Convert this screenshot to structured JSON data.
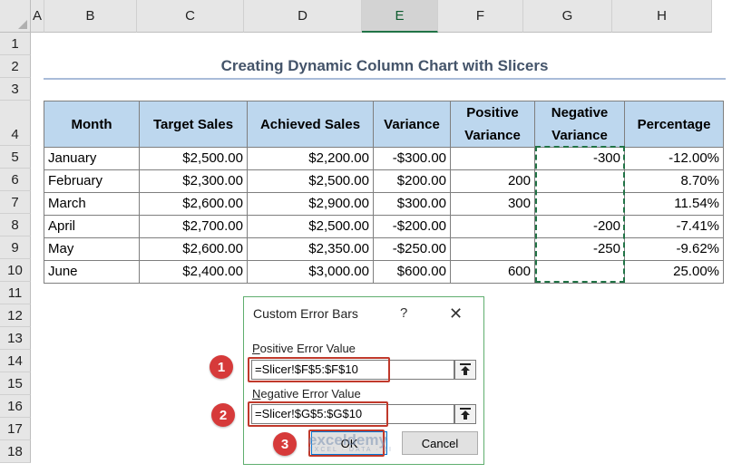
{
  "columns": [
    "A",
    "B",
    "C",
    "D",
    "E",
    "F",
    "G",
    "H"
  ],
  "rows": [
    "1",
    "2",
    "3",
    "4",
    "5",
    "6",
    "7",
    "8",
    "9",
    "10",
    "11",
    "12",
    "13",
    "14",
    "15",
    "16",
    "17",
    "18"
  ],
  "title": "Creating Dynamic Column Chart with Slicers",
  "table": {
    "headers": [
      "Month",
      "Target Sales",
      "Achieved Sales",
      "Variance",
      "Positive Variance",
      "Negative Variance",
      "Percentage"
    ],
    "rows": [
      [
        "January",
        "$2,500.00",
        "$2,200.00",
        "-$300.00",
        "",
        "-300",
        "-12.00%"
      ],
      [
        "February",
        "$2,300.00",
        "$2,500.00",
        "$200.00",
        "200",
        "",
        "8.70%"
      ],
      [
        "March",
        "$2,600.00",
        "$2,900.00",
        "$300.00",
        "300",
        "",
        "11.54%"
      ],
      [
        "April",
        "$2,700.00",
        "$2,500.00",
        "-$200.00",
        "",
        "-200",
        "-7.41%"
      ],
      [
        "May",
        "$2,600.00",
        "$2,350.00",
        "-$250.00",
        "",
        "-250",
        "-9.62%"
      ],
      [
        "June",
        "$2,400.00",
        "$3,000.00",
        "$600.00",
        "600",
        "",
        "25.00%"
      ]
    ]
  },
  "dialog": {
    "title": "Custom Error Bars",
    "help": "?",
    "close": "✕",
    "positive_label_first": "P",
    "positive_label_rest": "ositive Error Value",
    "positive_value": "=Slicer!$F$5:$F$10",
    "negative_label_first": "N",
    "negative_label_rest": "egative Error Value",
    "negative_value": "=Slicer!$G$5:$G$10",
    "ok_label": "OK",
    "cancel_label": "Cancel"
  },
  "callouts": [
    "1",
    "2",
    "3"
  ],
  "watermark": {
    "name": "exceldemy",
    "tagline": "EXCEL · DATA · BI"
  },
  "colors": {
    "header_fill": "#bdd7ee",
    "title": "#44546a",
    "accent_green": "#217346",
    "callout_red": "#d63a3a"
  }
}
